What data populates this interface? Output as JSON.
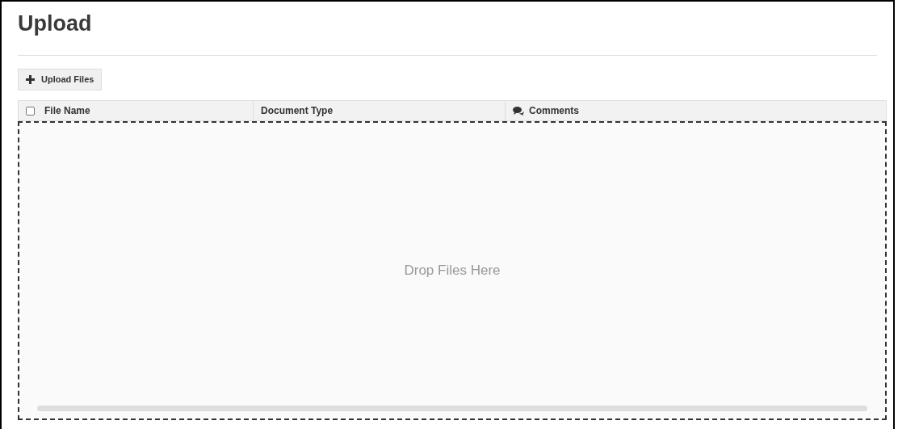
{
  "title": "Upload",
  "upload_button": {
    "label": "Upload Files"
  },
  "table": {
    "select_all": {
      "checked": false
    },
    "columns": [
      {
        "label": "File Name",
        "kind": "plain"
      },
      {
        "label": "Document Type",
        "kind": "plain"
      },
      {
        "label": "Comments",
        "kind": "comments"
      }
    ]
  },
  "drop_zone": {
    "hint": "Drop Files Here"
  }
}
